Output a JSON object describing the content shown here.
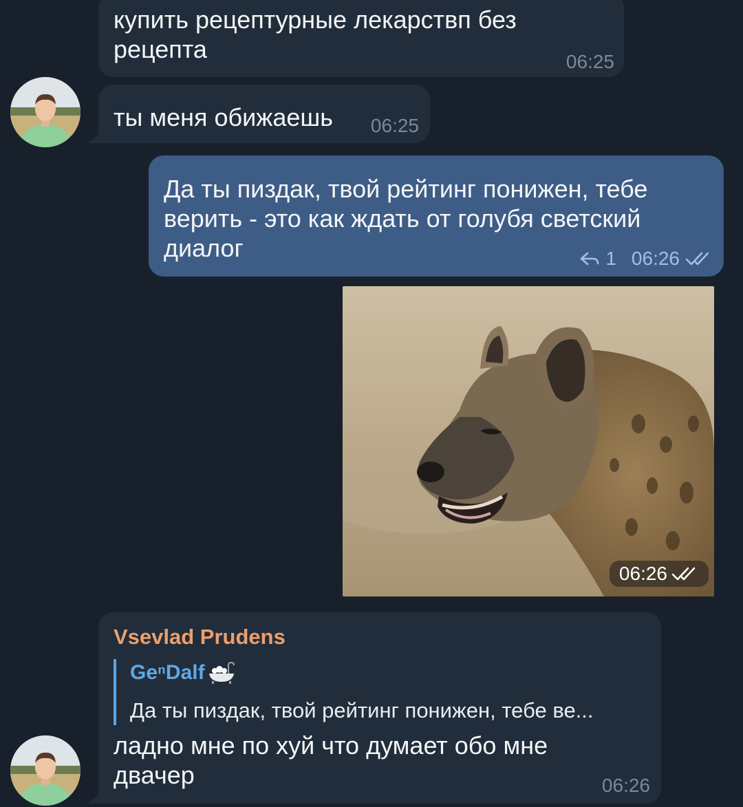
{
  "messages": {
    "m1": {
      "text": "купить рецептурные лекарствп без рецепта",
      "time": "06:25"
    },
    "m2": {
      "text": "ты меня обижаешь",
      "time": "06:25"
    },
    "m3": {
      "text": "Да ты пиздак, твой рейтинг понижен, тебе верить - это как ждать от голубя светский диалог",
      "reply_count": "1",
      "time": "06:26"
    },
    "m4": {
      "time": "06:26",
      "photo_subject": "hyena"
    },
    "m5": {
      "sender": "Vsevlad Prudens",
      "reply_name": "GeⁿDalf",
      "reply_text": "Да ты пиздак, твой рейтинг понижен, тебе ве...",
      "text": "ладно мне по хуй что думает обо мне двачер",
      "time": "06:26"
    }
  },
  "colors": {
    "background": "#18202c",
    "incoming_bubble": "#222d3b",
    "outgoing_bubble": "#3e5d86",
    "sender_name": "#ec9f6b",
    "reply_accent": "#5aa7e3"
  },
  "icons": [
    "reply-arrow-icon",
    "double-check-icon",
    "bathtub-emoji-icon"
  ]
}
